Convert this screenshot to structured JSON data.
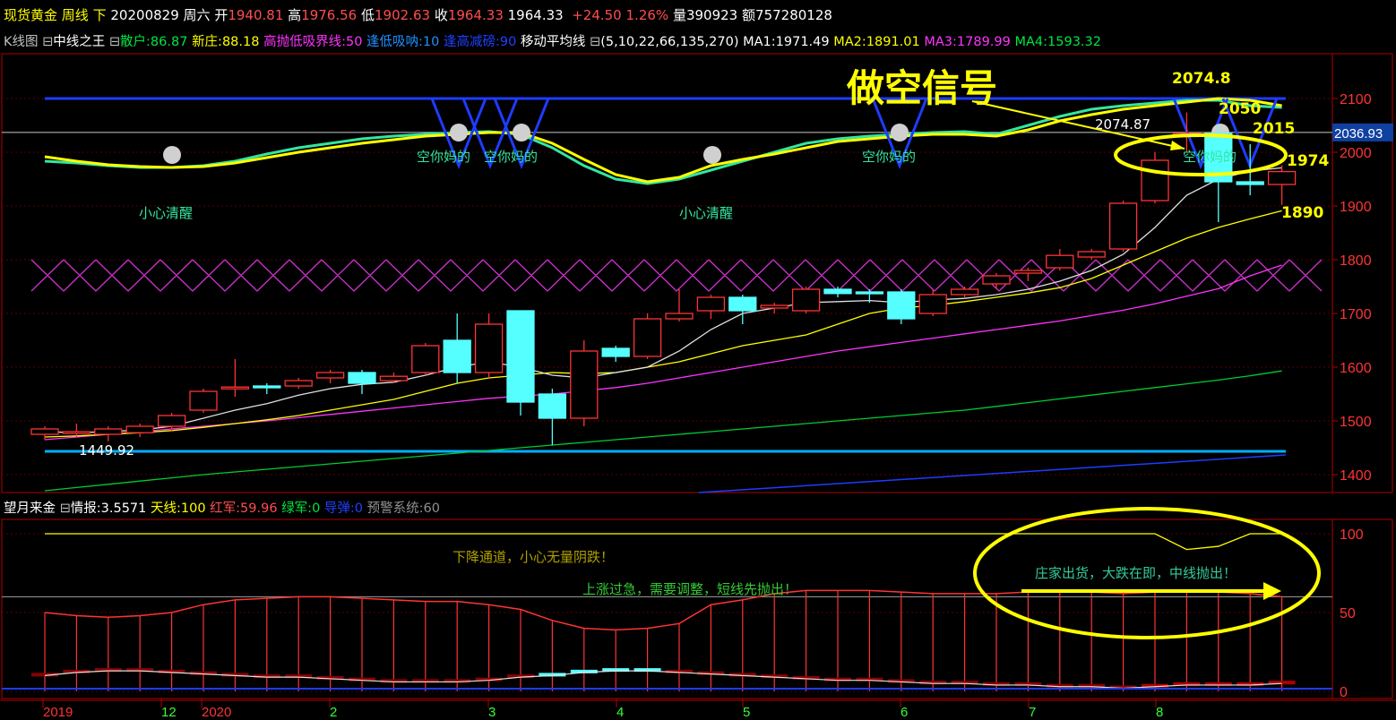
{
  "header": {
    "symbol": "现货黄金",
    "period": "周线",
    "direction": "下",
    "date": "20200829",
    "weekday": "周六",
    "open_label": "开",
    "open": "1940.81",
    "high_label": "高",
    "high": "1976.56",
    "low_label": "低",
    "low": "1902.63",
    "close_label": "收",
    "close": "1964.33",
    "last": "1964.33",
    "change": "+24.50",
    "change_pct": "1.26%",
    "volume_label": "量",
    "volume": "390923",
    "amount_label": "额",
    "amount": "757280128"
  },
  "indicator_bar": {
    "kline_label": "K线图",
    "box1": "⊟",
    "zx_label": "中线之王",
    "box2": "⊟",
    "sanhu": "散户:86.87",
    "xinzhuang": "新庄:88.18",
    "gaopao": "高抛低吸界线:50",
    "fengdi": "逢低吸呐:10",
    "fenggao": "逢高减磅:90",
    "ma_label": "移动平均线",
    "box3": "⊟",
    "ma_params": "(5,10,22,66,135,270)",
    "ma1": "MA1:1971.49",
    "ma2": "MA2:1891.01",
    "ma3": "MA3:1789.99",
    "ma4": "MA4:1593.32"
  },
  "sub_bar": {
    "name": "望月来金",
    "box": "⊟",
    "qingbao": "情报:3.5571",
    "tianxian": "天线:100",
    "hongjun": "红军:59.96",
    "lvjun": "绿军:0",
    "daodan": "导弹:0",
    "yujing": "预警系统:60"
  },
  "price_axis": [
    "2100",
    "2000",
    "1900",
    "1800",
    "1700",
    "1600",
    "1500",
    "1400"
  ],
  "sub_axis": [
    "100",
    "50",
    "0"
  ],
  "current_price_tag": "2036.93",
  "annotations": {
    "big_signal": "做空信号",
    "high1": "2074.8",
    "high2": "2074.87",
    "v2050": "2050",
    "v2015": "2015",
    "v1974": "1974",
    "v1890": "1890",
    "low": "1449.92",
    "xiaoxin1": "小心清醒",
    "xiaoxin2": "小心清醒",
    "kong1": "空你妈的",
    "kong2": "空你妈的",
    "kong3": "空你妈的",
    "kong4": "空你妈的",
    "sub1": "下降通道，小心无量阴跌！",
    "sub2": "上涨过急，需要调整，短线先抛出！",
    "sub3": "庄家出货，大跌在即，中线抛出！"
  },
  "time_axis": [
    "2019",
    "12",
    "2020",
    "2",
    "3",
    "4",
    "5",
    "6",
    "7",
    "8"
  ],
  "chart_data": {
    "type": "candlestick",
    "price_range": [
      1380,
      2140
    ],
    "candles": [
      {
        "o": 1475,
        "c": 1485,
        "h": 1490,
        "l": 1465
      },
      {
        "o": 1478,
        "c": 1480,
        "h": 1495,
        "l": 1470
      },
      {
        "o": 1475,
        "c": 1485,
        "h": 1490,
        "l": 1462
      },
      {
        "o": 1478,
        "c": 1490,
        "h": 1495,
        "l": 1470
      },
      {
        "o": 1490,
        "c": 1510,
        "h": 1515,
        "l": 1480
      },
      {
        "o": 1520,
        "c": 1555,
        "h": 1560,
        "l": 1515
      },
      {
        "o": 1560,
        "c": 1563,
        "h": 1615,
        "l": 1545
      },
      {
        "o": 1565,
        "c": 1562,
        "h": 1570,
        "l": 1550
      },
      {
        "o": 1565,
        "c": 1575,
        "h": 1580,
        "l": 1560
      },
      {
        "o": 1580,
        "c": 1590,
        "h": 1595,
        "l": 1570
      },
      {
        "o": 1590,
        "c": 1570,
        "h": 1595,
        "l": 1550
      },
      {
        "o": 1575,
        "c": 1583,
        "h": 1590,
        "l": 1570
      },
      {
        "o": 1590,
        "c": 1640,
        "h": 1645,
        "l": 1585
      },
      {
        "o": 1650,
        "c": 1590,
        "h": 1700,
        "l": 1570
      },
      {
        "o": 1590,
        "c": 1680,
        "h": 1700,
        "l": 1580
      },
      {
        "o": 1705,
        "c": 1535,
        "h": 1705,
        "l": 1510
      },
      {
        "o": 1550,
        "c": 1505,
        "h": 1560,
        "l": 1455
      },
      {
        "o": 1505,
        "c": 1630,
        "h": 1650,
        "l": 1490
      },
      {
        "o": 1635,
        "c": 1620,
        "h": 1640,
        "l": 1610
      },
      {
        "o": 1620,
        "c": 1690,
        "h": 1700,
        "l": 1615
      },
      {
        "o": 1690,
        "c": 1700,
        "h": 1745,
        "l": 1685
      },
      {
        "o": 1705,
        "c": 1730,
        "h": 1735,
        "l": 1690
      },
      {
        "o": 1730,
        "c": 1705,
        "h": 1735,
        "l": 1680
      },
      {
        "o": 1710,
        "c": 1715,
        "h": 1720,
        "l": 1700
      },
      {
        "o": 1705,
        "c": 1745,
        "h": 1750,
        "l": 1700
      },
      {
        "o": 1745,
        "c": 1737,
        "h": 1750,
        "l": 1730
      },
      {
        "o": 1740,
        "c": 1738,
        "h": 1745,
        "l": 1720
      },
      {
        "o": 1740,
        "c": 1690,
        "h": 1745,
        "l": 1680
      },
      {
        "o": 1700,
        "c": 1735,
        "h": 1745,
        "l": 1695
      },
      {
        "o": 1735,
        "c": 1745,
        "h": 1750,
        "l": 1730
      },
      {
        "o": 1755,
        "c": 1770,
        "h": 1775,
        "l": 1745
      },
      {
        "o": 1775,
        "c": 1780,
        "h": 1785,
        "l": 1760
      },
      {
        "o": 1785,
        "c": 1808,
        "h": 1820,
        "l": 1780
      },
      {
        "o": 1805,
        "c": 1815,
        "h": 1820,
        "l": 1800
      },
      {
        "o": 1820,
        "c": 1905,
        "h": 1910,
        "l": 1815
      },
      {
        "o": 1910,
        "c": 1985,
        "h": 2000,
        "l": 1905
      },
      {
        "o": 2030,
        "c": 2035,
        "h": 2074,
        "l": 2000
      },
      {
        "o": 2035,
        "c": 1945,
        "h": 2050,
        "l": 1870
      },
      {
        "o": 1945,
        "c": 1940,
        "h": 2015,
        "l": 1920
      },
      {
        "o": 1940,
        "c": 1964,
        "h": 1976,
        "l": 1902
      }
    ],
    "ma1": [
      1480,
      1478,
      1480,
      1483,
      1490,
      1505,
      1520,
      1532,
      1548,
      1560,
      1568,
      1572,
      1585,
      1600,
      1610,
      1600,
      1585,
      1580,
      1590,
      1600,
      1630,
      1670,
      1700,
      1710,
      1720,
      1722,
      1724,
      1720,
      1725,
      1728,
      1735,
      1745,
      1760,
      1780,
      1810,
      1860,
      1920,
      1950,
      1965,
      1971
    ],
    "ma2": [
      1470,
      1472,
      1475,
      1478,
      1482,
      1488,
      1495,
      1502,
      1510,
      1520,
      1530,
      1540,
      1555,
      1570,
      1580,
      1585,
      1590,
      1588,
      1590,
      1600,
      1610,
      1625,
      1640,
      1650,
      1660,
      1680,
      1700,
      1710,
      1715,
      1722,
      1730,
      1738,
      1748,
      1765,
      1790,
      1815,
      1840,
      1860,
      1876,
      1891
    ],
    "ma3": [
      1465,
      1470,
      1475,
      1480,
      1485,
      1490,
      1495,
      1500,
      1506,
      1512,
      1518,
      1524,
      1530,
      1536,
      1542,
      1546,
      1550,
      1556,
      1562,
      1570,
      1580,
      1590,
      1600,
      1610,
      1620,
      1630,
      1638,
      1646,
      1654,
      1662,
      1670,
      1678,
      1686,
      1696,
      1706,
      1718,
      1732,
      1746,
      1770,
      1790
    ],
    "ma4": [
      1370,
      1376,
      1382,
      1388,
      1394,
      1400,
      1405,
      1410,
      1415,
      1420,
      1425,
      1430,
      1435,
      1440,
      1445,
      1450,
      1455,
      1460,
      1465,
      1470,
      1475,
      1480,
      1485,
      1490,
      1495,
      1500,
      1505,
      1510,
      1515,
      1520,
      1527,
      1534,
      1541,
      1548,
      1555,
      1562,
      1569,
      1576,
      1584,
      1593
    ],
    "sub_red": [
      50,
      48,
      47,
      48,
      50,
      55,
      58,
      59,
      60,
      60,
      59,
      58,
      57,
      57,
      55,
      52,
      45,
      40,
      39,
      40,
      43,
      55,
      58,
      62,
      64,
      64,
      64,
      63,
      62,
      62,
      62,
      63,
      64,
      63,
      62,
      63,
      64,
      63,
      62,
      60
    ]
  },
  "colors": {
    "up": "#ff3333",
    "down": "#55ffff",
    "ma1": "#e0e0e0",
    "ma2": "#ffff00",
    "ma3": "#ff33ff",
    "ma4": "#00cc33",
    "signal": "#ffff00"
  }
}
